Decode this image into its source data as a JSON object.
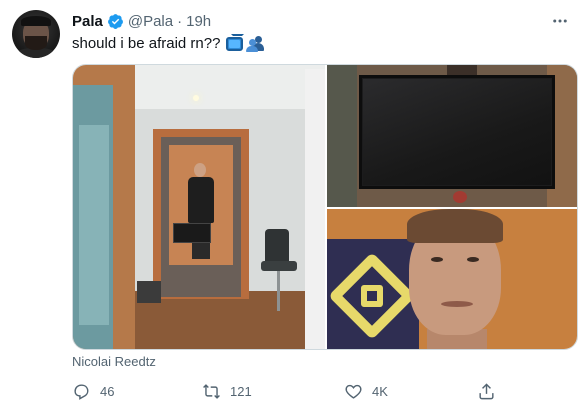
{
  "author": {
    "name": "Pala",
    "handle": "@Pala",
    "separator": "·",
    "time": "19h",
    "verified": true
  },
  "tweet": {
    "text": "should i be afraid rn??",
    "emojis": [
      "tv-icon",
      "people-icon"
    ]
  },
  "media": {
    "caption": "Nicolai Reedtz",
    "photos": [
      "room-photo",
      "monitor-photo",
      "face-photo"
    ]
  },
  "actions": {
    "reply_count": "46",
    "retweet_count": "121",
    "like_count": "4K"
  },
  "colors": {
    "verified_blue": "#1d9bf0",
    "text_primary": "#0f1419",
    "text_secondary": "#536471"
  }
}
